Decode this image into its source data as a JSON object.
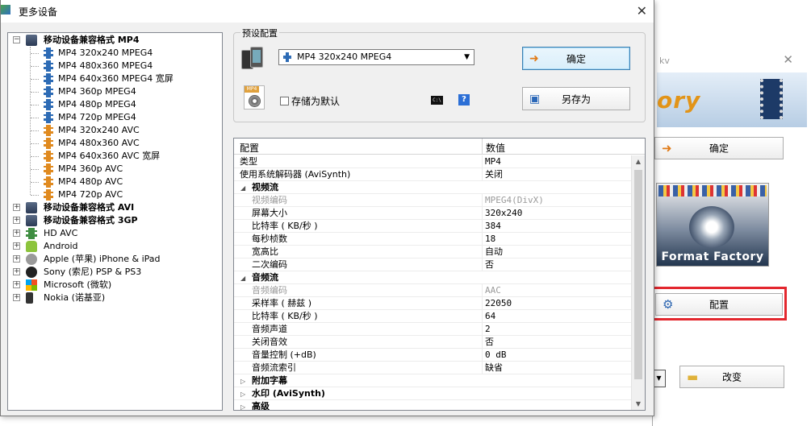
{
  "background_window": {
    "title_fragment": "kv",
    "banner_text": "ory",
    "ok_label": "确定",
    "format_factory_label": "Format Factory",
    "config_label": "配置",
    "change_label": "改变"
  },
  "dialog": {
    "title": "更多设备",
    "tree": {
      "groups": [
        {
          "label": "移动设备兼容格式 MP4",
          "expanded": true,
          "bold": true,
          "icon": "mobile-devices-icon",
          "children": [
            {
              "label": "MP4 320x240 MPEG4",
              "icon": "film-blue-icon"
            },
            {
              "label": "MP4 480x360 MPEG4",
              "icon": "film-blue-icon"
            },
            {
              "label": "MP4 640x360 MPEG4 宽屏",
              "icon": "film-blue-icon"
            },
            {
              "label": "MP4 360p MPEG4",
              "icon": "film-blue-icon"
            },
            {
              "label": "MP4 480p MPEG4",
              "icon": "film-blue-icon"
            },
            {
              "label": "MP4 720p MPEG4",
              "icon": "film-blue-icon"
            },
            {
              "label": "MP4 320x240 AVC",
              "icon": "film-orange-icon"
            },
            {
              "label": "MP4 480x360 AVC",
              "icon": "film-orange-icon"
            },
            {
              "label": "MP4 640x360 AVC 宽屏",
              "icon": "film-orange-icon"
            },
            {
              "label": "MP4 360p AVC",
              "icon": "film-orange-icon"
            },
            {
              "label": "MP4 480p AVC",
              "icon": "film-orange-icon"
            },
            {
              "label": "MP4 720p AVC",
              "icon": "film-orange-icon"
            }
          ]
        },
        {
          "label": "移动设备兼容格式 AVI",
          "expanded": false,
          "bold": true,
          "icon": "mobile-devices-icon"
        },
        {
          "label": "移动设备兼容格式 3GP",
          "expanded": false,
          "bold": true,
          "icon": "mobile-devices-icon"
        },
        {
          "label": "HD AVC",
          "expanded": false,
          "bold": false,
          "icon": "film-green-icon"
        },
        {
          "label": "Android",
          "expanded": false,
          "bold": false,
          "icon": "android-icon"
        },
        {
          "label": "Apple (苹果) iPhone & iPad",
          "expanded": false,
          "bold": false,
          "icon": "apple-icon"
        },
        {
          "label": "Sony (索尼) PSP & PS3",
          "expanded": false,
          "bold": false,
          "icon": "sony-psp-icon"
        },
        {
          "label": "Microsoft (微软)",
          "expanded": false,
          "bold": false,
          "icon": "microsoft-icon"
        },
        {
          "label": "Nokia (诺基亚)",
          "expanded": false,
          "bold": false,
          "icon": "nokia-icon"
        }
      ]
    },
    "preset": {
      "group_label": "预设配置",
      "selected": "MP4 320x240 MPEG4",
      "ok_label": "确定",
      "save_as_label": "另存为",
      "save_default_label": "存储为默认",
      "save_default_checked": false,
      "cmd_icon_text": "C:\\",
      "help_icon_text": "?"
    },
    "grid": {
      "header_key": "配置",
      "header_value": "数值",
      "rows": [
        {
          "type": "item",
          "key": "类型",
          "value": "MP4"
        },
        {
          "type": "item",
          "key": "使用系统解码器 (AviSynth)",
          "value": "关闭"
        },
        {
          "type": "category",
          "key": "视频流",
          "expanded": true
        },
        {
          "type": "sub",
          "key": "视频编码",
          "value": "MPEG4(DivX)",
          "disabled": true
        },
        {
          "type": "sub",
          "key": "屏幕大小",
          "value": "320x240"
        },
        {
          "type": "sub",
          "key": "比特率 ( KB/秒 )",
          "value": "384"
        },
        {
          "type": "sub",
          "key": "每秒桢数",
          "value": "18"
        },
        {
          "type": "sub",
          "key": "宽高比",
          "value": "自动"
        },
        {
          "type": "sub",
          "key": "二次编码",
          "value": "否"
        },
        {
          "type": "category",
          "key": "音频流",
          "expanded": true
        },
        {
          "type": "sub",
          "key": "音频编码",
          "value": "AAC",
          "disabled": true
        },
        {
          "type": "sub",
          "key": "采样率 ( 赫兹 )",
          "value": "22050"
        },
        {
          "type": "sub",
          "key": "比特率 ( KB/秒 )",
          "value": "64"
        },
        {
          "type": "sub",
          "key": "音频声道",
          "value": "2"
        },
        {
          "type": "sub",
          "key": "关闭音效",
          "value": "否"
        },
        {
          "type": "sub",
          "key": "音量控制 (+dB)",
          "value": "0 dB"
        },
        {
          "type": "sub",
          "key": "音频流索引",
          "value": "缺省"
        },
        {
          "type": "category",
          "key": "附加字幕",
          "expanded": false
        },
        {
          "type": "category",
          "key": "水印 (AviSynth)",
          "expanded": false
        },
        {
          "type": "category",
          "key": "高级",
          "expanded": false
        }
      ]
    }
  },
  "colors": {
    "highlight_border": "#e3272e",
    "ok_button_border": "#3c7fb1"
  }
}
